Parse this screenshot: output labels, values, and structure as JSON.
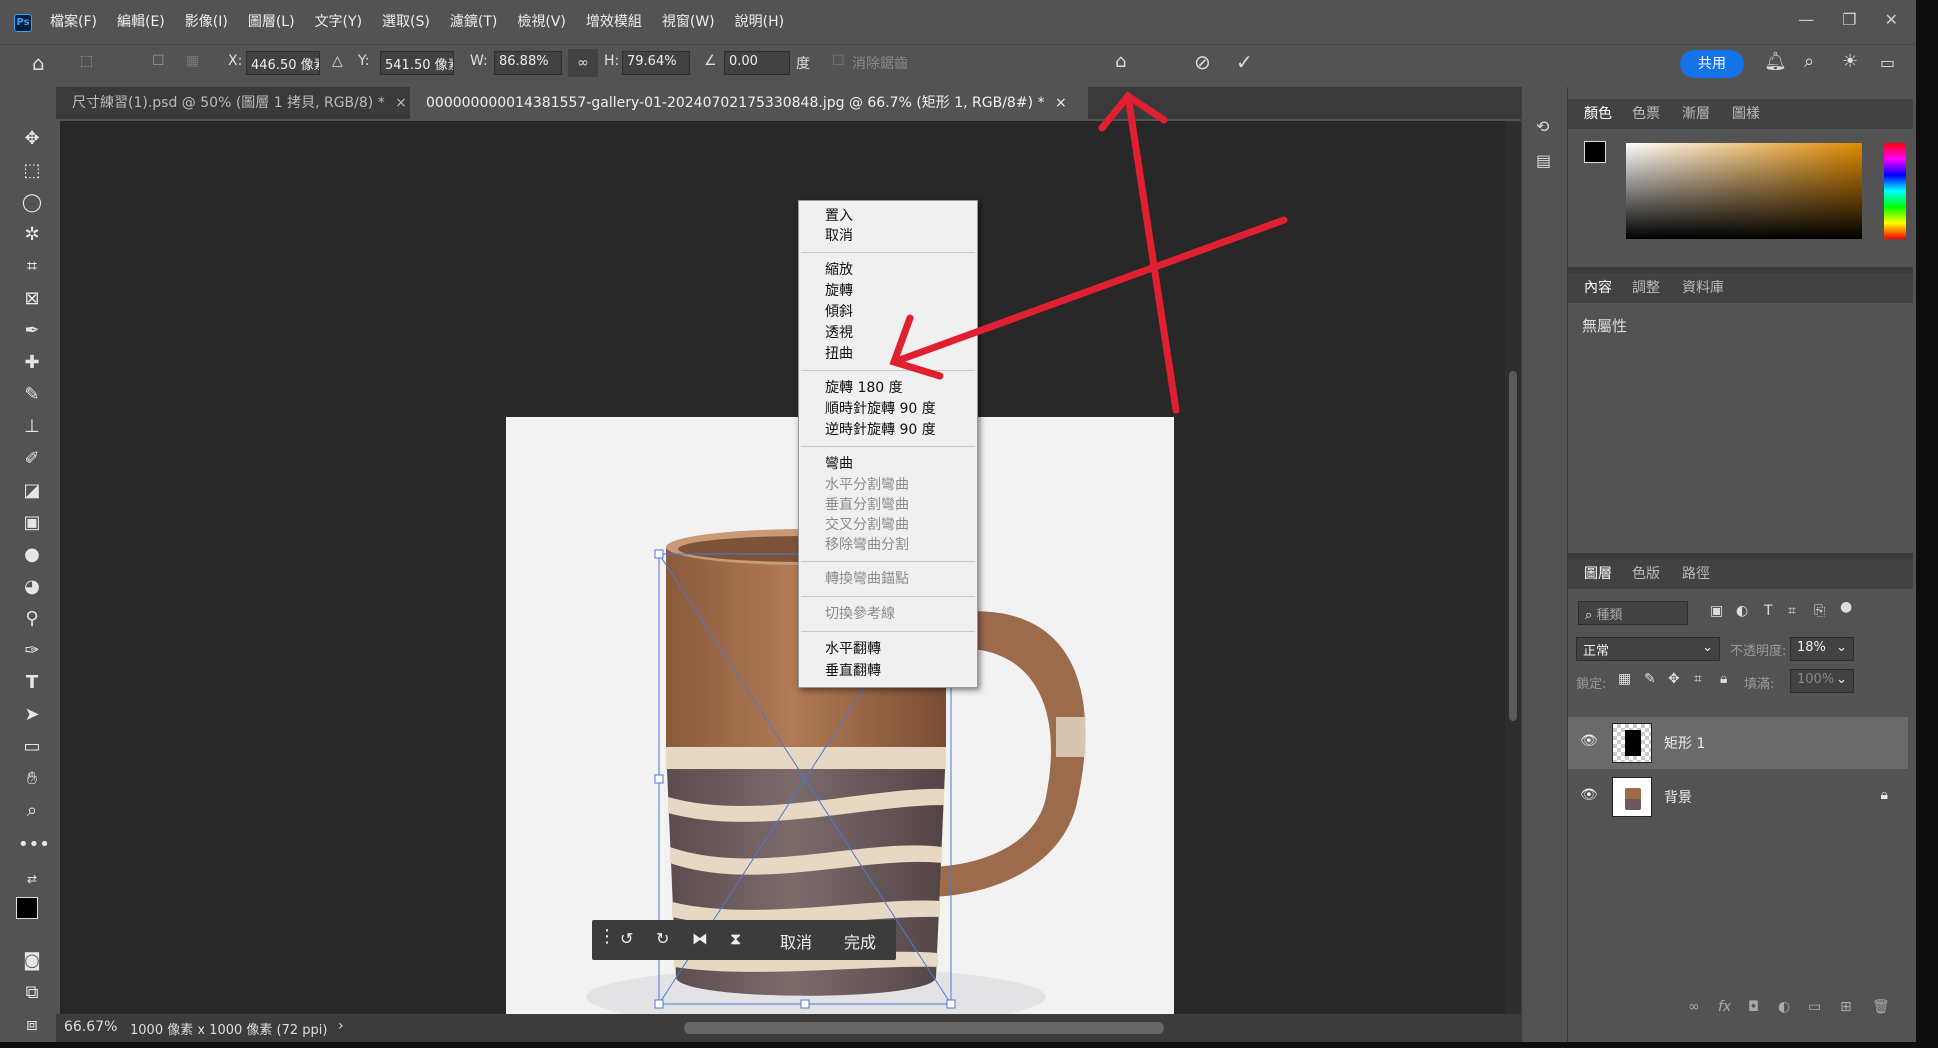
{
  "menubar": {
    "logo": "Ps",
    "items": [
      "檔案(F)",
      "編輯(E)",
      "影像(I)",
      "圖層(L)",
      "文字(Y)",
      "選取(S)",
      "濾鏡(T)",
      "檢視(V)",
      "增效模組",
      "視窗(W)",
      "說明(H)"
    ]
  },
  "options": {
    "x_label": "X:",
    "x_value": "446.50 像素",
    "y_label": "Y:",
    "y_value": "541.50 像素",
    "w_label": "W:",
    "w_value": "86.88%",
    "h_label": "H:",
    "h_value": "79.64%",
    "angle_value": "0.00",
    "angle_unit": "度",
    "antialias_label": "消除鋸齒",
    "share_label": "共用"
  },
  "tabs": [
    {
      "label": "尺寸練習(1).psd @ 50% (圖層 1 拷貝, RGB/8) *",
      "active": false
    },
    {
      "label": "000000000014381557-gallery-01-20240702175330848.jpg @ 66.7% (矩形 1, RGB/8#) *",
      "active": true
    }
  ],
  "context_menu": {
    "group1": [
      "置入",
      "取消"
    ],
    "group2": [
      "縮放",
      "旋轉",
      "傾斜",
      "透視",
      "扭曲"
    ],
    "group3": [
      "旋轉 180 度",
      "順時針旋轉 90 度",
      "逆時針旋轉 90 度"
    ],
    "warp": "彎曲",
    "warp_disabled": [
      "水平分割彎曲",
      "垂直分割彎曲",
      "交叉分割彎曲",
      "移除彎曲分割"
    ],
    "convert_anchor": "轉換彎曲錨點",
    "toggle_guides": "切換參考線",
    "flip": [
      "水平翻轉",
      "垂直翻轉"
    ]
  },
  "transform_bar": {
    "cancel": "取消",
    "done": "完成"
  },
  "status": {
    "zoom": "66.67%",
    "doc_info": "1000 像素 x 1000 像素 (72 ppi)"
  },
  "color_panel": {
    "tabs": [
      "顏色",
      "色票",
      "漸層",
      "圖樣"
    ]
  },
  "properties_panel": {
    "tabs": [
      "內容",
      "調整",
      "資料庫"
    ],
    "body": "無屬性"
  },
  "layers_panel": {
    "tabs": [
      "圖層",
      "色版",
      "路徑"
    ],
    "filter_placeholder": "種類",
    "blend_mode": "正常",
    "opacity_label": "不透明度:",
    "opacity_value": "18%",
    "lock_label": "鎖定:",
    "fill_label": "填滿:",
    "fill_value": "100%",
    "layers": [
      {
        "name": "矩形 1",
        "selected": true
      },
      {
        "name": "背景",
        "selected": false
      }
    ]
  },
  "colors": {
    "accent": "#1473e6",
    "annotation": "#e02030",
    "panel": "#535353",
    "canvas": "#282828"
  }
}
